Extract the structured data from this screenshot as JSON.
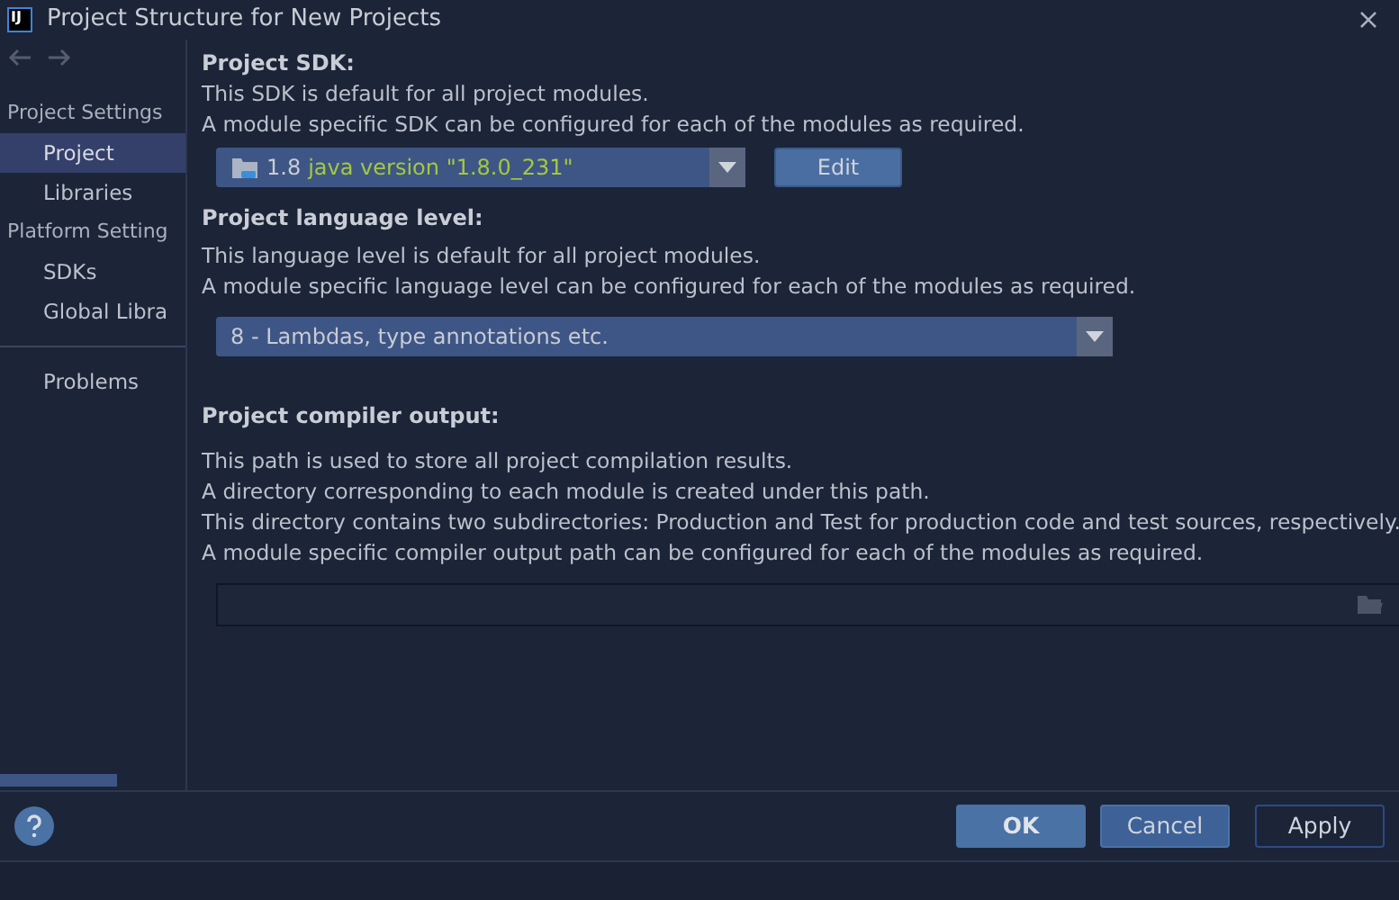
{
  "window": {
    "logo": "IJ",
    "title": "Project Structure for New Projects"
  },
  "sidebar": {
    "groups": [
      {
        "heading": "Project Settings",
        "items": [
          {
            "label": "Project",
            "selected": true
          },
          {
            "label": "Libraries",
            "selected": false
          }
        ]
      },
      {
        "heading": "Platform Setting",
        "items": [
          {
            "label": "SDKs",
            "selected": false
          },
          {
            "label": "Global Libra",
            "selected": false
          }
        ]
      },
      {
        "items": [
          {
            "label": "Problems",
            "selected": false
          }
        ]
      }
    ]
  },
  "sdk": {
    "heading": "Project SDK:",
    "lines": [
      "This SDK is default for all project modules.",
      "A module specific SDK can be configured for each of the modules as required."
    ],
    "version": "1.8",
    "detail": "java version \"1.8.0_231\"",
    "edit_button": "Edit"
  },
  "language": {
    "heading": "Project language level:",
    "lines": [
      "This language level is default for all project modules.",
      "A module specific language level can be configured for each of the modules as required."
    ],
    "value": "8 - Lambdas, type annotations etc."
  },
  "compiler": {
    "heading": "Project compiler output:",
    "lines": [
      "This path is used to store all project compilation results.",
      "A directory corresponding to each module is created under this path.",
      "This directory contains two subdirectories: Production and Test for production code and test sources, respectively.",
      "A module specific compiler output path can be configured for each of the modules as required."
    ]
  },
  "buttons": [
    {
      "label": "OK",
      "kind": "default"
    },
    {
      "label": "Cancel",
      "kind": "primary"
    },
    {
      "label": "Apply",
      "kind": "outline"
    }
  ]
}
